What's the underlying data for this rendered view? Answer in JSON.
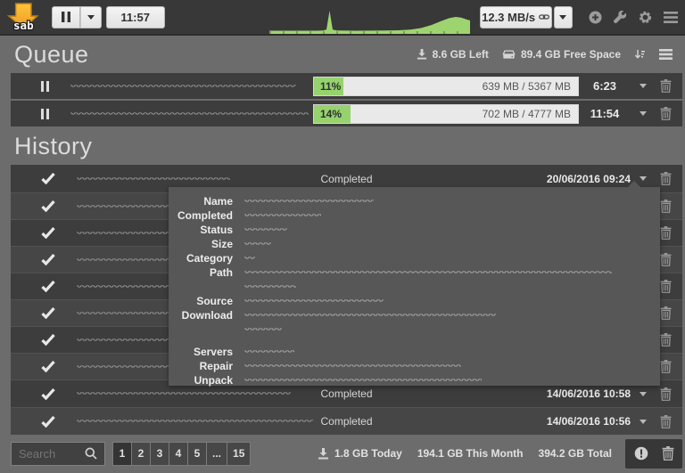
{
  "topbar": {
    "timer": "11:57",
    "speed": "12.3 MB/s"
  },
  "queue": {
    "title": "Queue",
    "remaining": "8.6 GB Left",
    "free_space": "89.4 GB Free Space",
    "rows": [
      {
        "percent_label": "11%",
        "progress": 11,
        "size": "639 MB / 5367 MB",
        "eta": "6:23"
      },
      {
        "percent_label": "14%",
        "progress": 14,
        "size": "702 MB / 4777 MB",
        "eta": "11:54"
      }
    ]
  },
  "history": {
    "title": "History",
    "rows": [
      {
        "status": "Completed",
        "date": "20/06/2016 09:24"
      },
      {},
      {},
      {},
      {},
      {},
      {},
      {},
      {
        "status": "Completed",
        "date": "14/06/2016 10:58"
      },
      {
        "status": "Completed",
        "date": "14/06/2016 10:56"
      }
    ]
  },
  "detail_panel": {
    "labels": {
      "name": "Name",
      "completed": "Completed",
      "status": "Status",
      "size": "Size",
      "category": "Category",
      "path": "Path",
      "source": "Source",
      "download": "Download",
      "servers": "Servers",
      "repair": "Repair",
      "unpack": "Unpack"
    }
  },
  "footer": {
    "search_placeholder": "Search",
    "pages": [
      "1",
      "2",
      "3",
      "4",
      "5",
      "...",
      "15"
    ],
    "stats": {
      "today": "1.8 GB Today",
      "month": "194.1 GB This Month",
      "total": "394.2 GB Total"
    }
  },
  "colors": {
    "accent_green": "#96d26e",
    "topbar": "#383838",
    "page_bg": "#6c6c6c",
    "row_bg": "#3d3d3d",
    "panel_bg": "#575757"
  }
}
